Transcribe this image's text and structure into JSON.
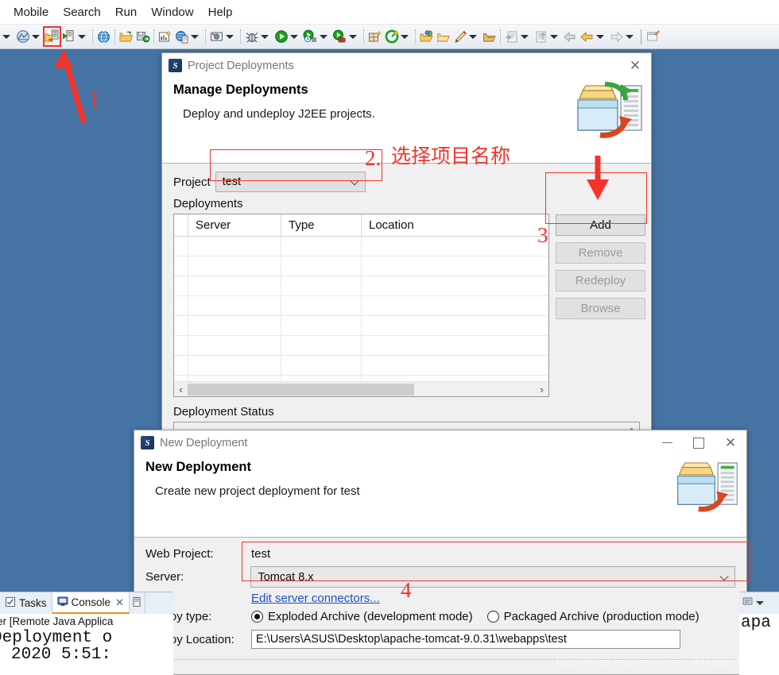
{
  "menubar": {
    "items": [
      {
        "label": "Mobile"
      },
      {
        "label": "Search"
      },
      {
        "label": "Run"
      },
      {
        "label": "Window"
      },
      {
        "label": "Help"
      }
    ]
  },
  "toolbar": {
    "items": [
      {
        "name": "dropdown-caret-0",
        "kind": "caret"
      },
      {
        "name": "java-perspective-icon",
        "kind": "icon"
      },
      {
        "name": "dropdown-caret-1",
        "kind": "caret"
      },
      {
        "name": "deploy-j2ee-projects-icon",
        "kind": "icon",
        "highlighted": true
      },
      {
        "name": "start-server-icon",
        "kind": "icon"
      },
      {
        "name": "dropdown-caret-2",
        "kind": "caret"
      },
      {
        "name": "separator-a",
        "kind": "sep"
      },
      {
        "name": "web-browser-icon",
        "kind": "icon"
      },
      {
        "name": "separator-b",
        "kind": "sep"
      },
      {
        "name": "open-folder-icon",
        "kind": "icon"
      },
      {
        "name": "save-as-icon",
        "kind": "icon"
      },
      {
        "name": "separator-c",
        "kind": "sep"
      },
      {
        "name": "new-wizard-icon",
        "kind": "icon"
      },
      {
        "name": "globe-page-icon",
        "kind": "icon"
      },
      {
        "name": "dropdown-caret-3",
        "kind": "caret"
      },
      {
        "name": "separator-d",
        "kind": "sep"
      },
      {
        "name": "screenshot-icon",
        "kind": "icon"
      },
      {
        "name": "dropdown-caret-4",
        "kind": "caret"
      },
      {
        "name": "separator-e",
        "kind": "sep"
      },
      {
        "name": "debug-bug-icon",
        "kind": "icon"
      },
      {
        "name": "dropdown-caret-5",
        "kind": "caret"
      },
      {
        "name": "run-icon",
        "kind": "icon"
      },
      {
        "name": "dropdown-caret-6",
        "kind": "caret"
      },
      {
        "name": "run-history-icon",
        "kind": "icon"
      },
      {
        "name": "dropdown-caret-7",
        "kind": "caret"
      },
      {
        "name": "external-tools-icon",
        "kind": "icon"
      },
      {
        "name": "dropdown-caret-8",
        "kind": "caret"
      },
      {
        "name": "separator-f",
        "kind": "sep"
      },
      {
        "name": "new-package-icon",
        "kind": "icon"
      },
      {
        "name": "green-target-icon",
        "kind": "icon"
      },
      {
        "name": "dropdown-caret-9",
        "kind": "caret"
      },
      {
        "name": "separator-g",
        "kind": "sep"
      },
      {
        "name": "open-type-icon",
        "kind": "icon"
      },
      {
        "name": "open-task-icon",
        "kind": "icon"
      },
      {
        "name": "pencil-icon",
        "kind": "icon"
      },
      {
        "name": "dropdown-caret-10",
        "kind": "caret"
      },
      {
        "name": "open-resource-icon",
        "kind": "icon"
      },
      {
        "name": "separator-h",
        "kind": "sep"
      },
      {
        "name": "next-annotation-icon",
        "kind": "icon"
      },
      {
        "name": "dropdown-caret-11",
        "kind": "caret"
      },
      {
        "name": "previous-annotation-icon",
        "kind": "icon"
      },
      {
        "name": "dropdown-caret-12",
        "kind": "caret"
      },
      {
        "name": "back-arrow-icon",
        "kind": "icon"
      },
      {
        "name": "forward-arrow-icon",
        "kind": "icon"
      },
      {
        "name": "dropdown-caret-13",
        "kind": "caret"
      },
      {
        "name": "next-edit-arrow-icon",
        "kind": "icon"
      },
      {
        "name": "dropdown-caret-14",
        "kind": "caret"
      },
      {
        "name": "pipe-separator",
        "kind": "pipe"
      },
      {
        "name": "new-editor-icon",
        "kind": "icon"
      }
    ]
  },
  "project_deployments_dialog": {
    "window_title": "Project Deployments",
    "close_label": "✕",
    "heading": "Manage Deployments",
    "subheading": "Deploy and undeploy J2EE projects.",
    "project_label": "Project",
    "project_value": "test",
    "deployments_label": "Deployments",
    "table": {
      "columns": [
        "Server",
        "Type",
        "Location"
      ],
      "rows": []
    },
    "scroll_left_glyph": "‹",
    "scroll_right_glyph": "›",
    "buttons": [
      {
        "label": "Add",
        "enabled": true
      },
      {
        "label": "Remove",
        "enabled": false
      },
      {
        "label": "Redeploy",
        "enabled": false
      },
      {
        "label": "Browse",
        "enabled": false
      }
    ],
    "status_label": "Deployment Status"
  },
  "new_deployment_dialog": {
    "window_title": "New Deployment",
    "minimize_label": "—",
    "maximize_label": "☐",
    "close_label": "✕",
    "heading": "New Deployment",
    "subheading": "Create new project deployment for test",
    "fields": {
      "web_project_label": "Web Project:",
      "web_project_value": "test",
      "server_label": "Server:",
      "server_value": "Tomcat  8.x",
      "edit_connectors_link": "Edit server connectors...",
      "deploy_type_label": "Deploy type:",
      "deploy_type_options": [
        {
          "label": "Exploded Archive (development mode)",
          "selected": true
        },
        {
          "label": "Packaged Archive (production mode)",
          "selected": false
        }
      ],
      "deploy_location_label": "Deploy Location:",
      "deploy_location_value": "E:\\Users\\ASUS\\Desktop\\apache-tomcat-9.0.31\\webapps\\test"
    }
  },
  "annotations": {
    "color": "#f4332b",
    "marks": [
      {
        "id": "1",
        "text": "1",
        "target": "toolbar deploy icon"
      },
      {
        "id": "2",
        "text": "2.",
        "note": "选择项目名称",
        "target": "project combo"
      },
      {
        "id": "3",
        "text": "3",
        "target": "Add button"
      },
      {
        "id": "4",
        "text": "4",
        "target": "server combo"
      }
    ],
    "chinese_note": "选择项目名称",
    "number_2": "2.",
    "number_1": "1",
    "number_3": "3",
    "number_4": "4"
  },
  "console_view": {
    "tabs": [
      {
        "label": "Tasks",
        "active": false,
        "icon": "tasks-icon"
      },
      {
        "label": "Console",
        "active": true,
        "icon": "console-icon"
      }
    ],
    "close_glyph": "✕",
    "launch_line": "er [Remote Java Applica",
    "output_line": "Deployment o",
    "output_line2": "2020 5:51:"
  },
  "right_editor_sliver": {
    "text": "apa"
  },
  "watermark": {
    "text": "https://blog.csdn.net/weixin_43920962"
  }
}
